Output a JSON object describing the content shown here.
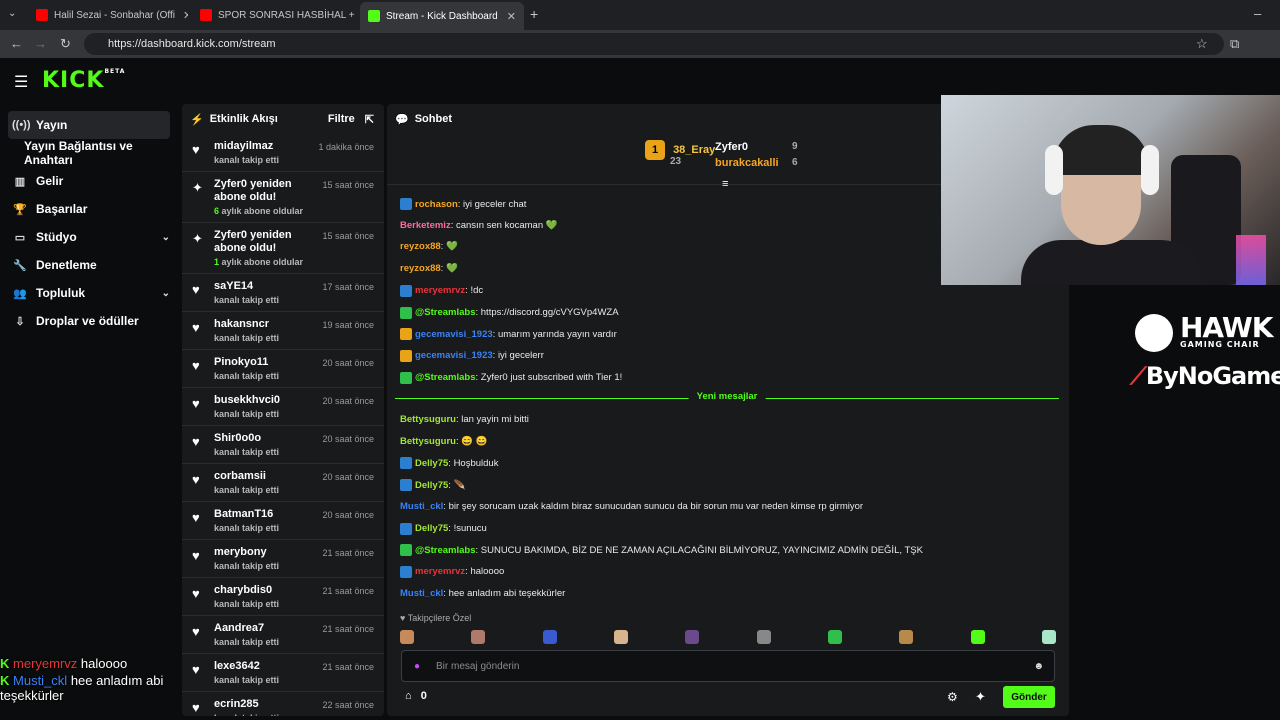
{
  "browser": {
    "tabs": [
      {
        "title": "Halil Sezai - Sonbahar (Offi",
        "active": false
      },
      {
        "title": "SPOR SONRASI HASBİHAL + P",
        "active": false
      },
      {
        "title": "Stream - Kick Dashboard",
        "active": true
      }
    ],
    "url": "https://dashboard.kick.com/stream"
  },
  "brand": {
    "logo": "KICK",
    "badge": "BETA",
    "accent": "#53fc18"
  },
  "sidebar": {
    "items": [
      {
        "label": "Yayın",
        "icon": "broadcast-icon",
        "active": true
      },
      {
        "label": "Yayın Bağlantısı ve Anahtarı",
        "icon": ""
      },
      {
        "label": "Gelir",
        "icon": "chart-icon"
      },
      {
        "label": "Başarılar",
        "icon": "trophy-icon"
      },
      {
        "label": "Stüdyo",
        "icon": "studio-icon"
      },
      {
        "label": "Denetleme",
        "icon": "wrench-icon"
      },
      {
        "label": "Topluluk",
        "icon": "community-icon"
      },
      {
        "label": "Droplar ve ödüller",
        "icon": "drops-icon"
      }
    ]
  },
  "overlay_chat": [
    {
      "user": "meryemrvz",
      "text": "haloooo"
    },
    {
      "user": "Musti_ckl",
      "text": "hee anladım abi teşekkürler"
    }
  ],
  "events": {
    "title": "Etkinlik Akışı",
    "filter_label": "Filtre",
    "items": [
      {
        "name": "midayilmaz",
        "sub": "kanalı takip etti",
        "time": "1 dakika önce"
      },
      {
        "name": "Zyfer0 yeniden abone oldu!",
        "months": "6",
        "sub": "aylık abone oldular",
        "time": "15 saat önce"
      },
      {
        "name": "Zyfer0 yeniden abone oldu!",
        "months": "1",
        "sub": "aylık abone oldular",
        "time": "15 saat önce"
      },
      {
        "name": "saYE14",
        "sub": "kanalı takip etti",
        "time": "17 saat önce"
      },
      {
        "name": "hakansncr",
        "sub": "kanalı takip etti",
        "time": "19 saat önce"
      },
      {
        "name": "Pinokyo11",
        "sub": "kanalı takip etti",
        "time": "20 saat önce"
      },
      {
        "name": "busekkhvci0",
        "sub": "kanalı takip etti",
        "time": "20 saat önce"
      },
      {
        "name": "Shir0o0o",
        "sub": "kanalı takip etti",
        "time": "20 saat önce"
      },
      {
        "name": "corbamsii",
        "sub": "kanalı takip etti",
        "time": "20 saat önce"
      },
      {
        "name": "BatmanT16",
        "sub": "kanalı takip etti",
        "time": "20 saat önce"
      },
      {
        "name": "merybony",
        "sub": "kanalı takip etti",
        "time": "21 saat önce"
      },
      {
        "name": "charybdis0",
        "sub": "kanalı takip etti",
        "time": "21 saat önce"
      },
      {
        "name": "Aandrea7",
        "sub": "kanalı takip etti",
        "time": "21 saat önce"
      },
      {
        "name": "lexe3642",
        "sub": "kanalı takip etti",
        "time": "21 saat önce"
      },
      {
        "name": "ecrin285",
        "sub": "kanalı takip etti",
        "time": "22 saat önce"
      }
    ]
  },
  "chat": {
    "title": "Sohbet",
    "leaderboard": [
      {
        "rank": "1",
        "name": "38_Eray",
        "count": "23"
      },
      {
        "name": "Zyfer0",
        "count": "9"
      },
      {
        "name": "burakcakalli",
        "count": "6"
      }
    ],
    "messages_old": [
      {
        "user": "rochason",
        "color": "#f5a623",
        "text": "iyi geceler chat"
      },
      {
        "user": "Berketemiz",
        "color": "#ff6b9a",
        "text": "cansın sen kocaman 💚"
      },
      {
        "user": "reyzox88",
        "color": "#f5a623",
        "text": "💚"
      },
      {
        "user": "reyzox88",
        "color": "#f5a623",
        "text": "💚"
      },
      {
        "user": "meryemrvz",
        "color": "#e8333a",
        "text": "!dc"
      },
      {
        "user": "@Streamlabs",
        "color": "#53fc18",
        "text": "https://discord.gg/cVYGVp4WZA"
      },
      {
        "user": "gecemavisi_1923",
        "color": "#3b82f6",
        "text": "umarım yarında yayın vardır"
      },
      {
        "user": "gecemavisi_1923",
        "color": "#3b82f6",
        "text": "iyi gecelerr"
      },
      {
        "user": "@Streamlabs",
        "color": "#53fc18",
        "text": "Zyfer0 just subscribed with Tier 1!"
      }
    ],
    "new_messages_label": "Yeni mesajlar",
    "messages_new": [
      {
        "user": "Bettysuguru",
        "color": "#a3e635",
        "text": "lan yayin mi bitti"
      },
      {
        "user": "Bettysuguru",
        "color": "#a3e635",
        "text": "😄 😄"
      },
      {
        "user": "Delly75",
        "color": "#a3e635",
        "text": "Hoşbulduk"
      },
      {
        "user": "Delly75",
        "color": "#a3e635",
        "text": "🪶"
      },
      {
        "user": "Musti_ckl",
        "color": "#3b82f6",
        "text": "bir şey sorucam uzak kaldım biraz sunucudan sunucu da bir sorun mu var neden kimse rp girmiyor"
      },
      {
        "user": "Delly75",
        "color": "#a3e635",
        "text": "!sunucu"
      },
      {
        "user": "@Streamlabs",
        "color": "#53fc18",
        "text": "SUNUCU BAKIMDA, BİZ DE NE ZAMAN AÇILACAĞINI BİLMİYORUZ, YAYINCIMIZ ADMİN DEĞİL, TŞK"
      },
      {
        "user": "meryemrvz",
        "color": "#e8333a",
        "text": "haloooo"
      },
      {
        "user": "Musti_ckl",
        "color": "#3b82f6",
        "text": "hee anladım abi teşekkürler"
      }
    ],
    "followers_only_label": "Takipçilere Özel",
    "input_placeholder": "Bir mesaj gönderin",
    "points": "0",
    "send_label": "Gönder"
  },
  "sponsors": {
    "line1": "HAWK",
    "line1_sub": "GAMING CHAIR",
    "line2": "ByNoGame"
  }
}
